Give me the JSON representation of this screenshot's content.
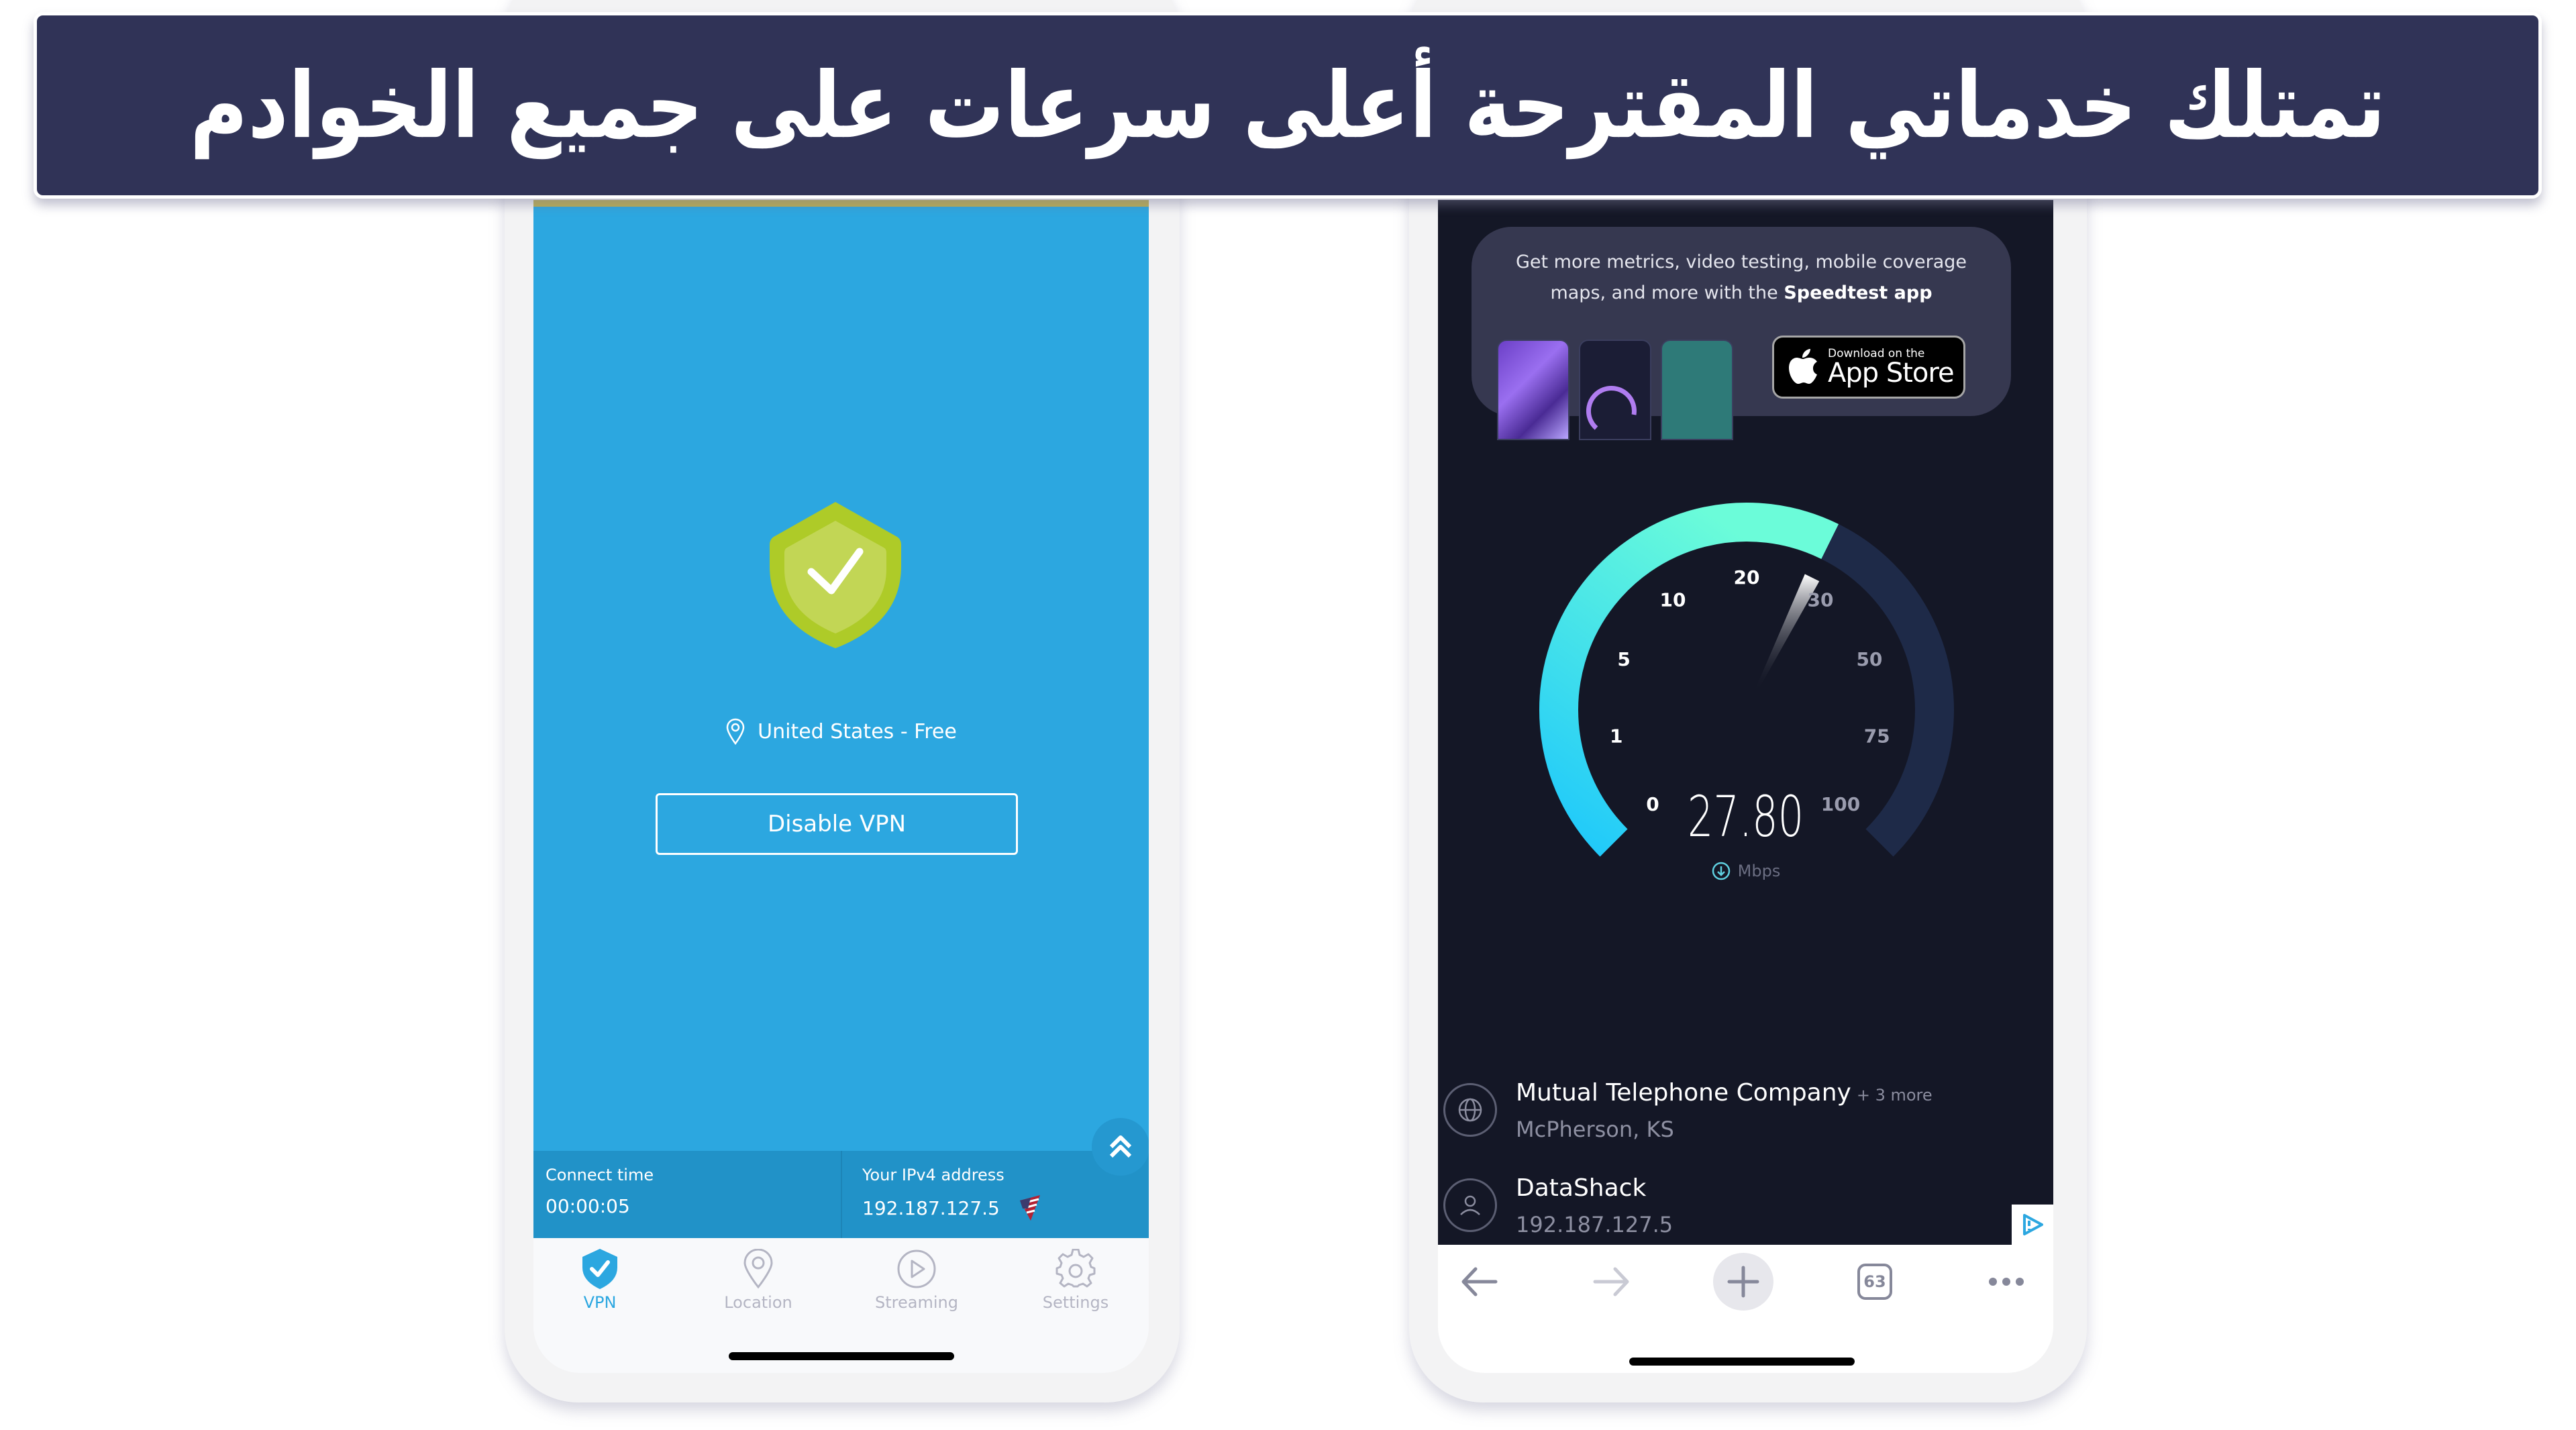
{
  "banner": {
    "title": "تمتلك خدماتي المقترحة أعلى سرعات على جميع الخوادم",
    "background": "#303357"
  },
  "vpn_app": {
    "accent": "#2ca7e0",
    "shield_icon": "shield-check-icon",
    "location_icon": "map-pin-icon",
    "location_label": "United States - Free",
    "disable_button_label": "Disable VPN",
    "expand_icon": "double-chevron-up-icon",
    "connect_time_label": "Connect time",
    "connect_time_value": "00:00:05",
    "ip_label": "Your IPv4 address",
    "ip_value": "192.187.127.5",
    "flag_icon": "us-flag-icon",
    "tabs": [
      {
        "label": "VPN",
        "icon": "shield-check-icon",
        "active": true
      },
      {
        "label": "Location",
        "icon": "map-pin-icon",
        "active": false
      },
      {
        "label": "Streaming",
        "icon": "play-circle-icon",
        "active": false
      },
      {
        "label": "Settings",
        "icon": "gear-icon",
        "active": false
      }
    ]
  },
  "speedtest": {
    "promo_text_line1": "Get more metrics, video testing, mobile coverage",
    "promo_text_line2_prefix": "maps, and more with the ",
    "promo_text_bold": "Speedtest app",
    "appstore_small": "Download on the",
    "appstore_big": "App Store",
    "gauge": {
      "ticks": [
        "0",
        "1",
        "5",
        "10",
        "20",
        "30",
        "50",
        "75",
        "100"
      ],
      "value": 27.8,
      "fill_colors": [
        "#1ec8fb",
        "#6bfcd9"
      ],
      "track_color": "#1e2a48"
    },
    "speed_value": "27.80",
    "speed_unit": "Mbps",
    "download_icon": "download-circle-icon",
    "providers": [
      {
        "icon": "globe-icon",
        "name": "Mutual Telephone Company",
        "more": "+ 3 more",
        "sub": "McPherson, KS"
      },
      {
        "icon": "user-icon",
        "name": "DataShack",
        "more": "",
        "sub": "192.187.127.5"
      }
    ],
    "ad_icon": "ad-choices-icon"
  },
  "browser_bar": {
    "tab_count": "63",
    "buttons": [
      "back-arrow-icon",
      "forward-arrow-icon",
      "new-tab-plus-icon",
      "tab-count-icon",
      "more-dots-icon"
    ]
  }
}
